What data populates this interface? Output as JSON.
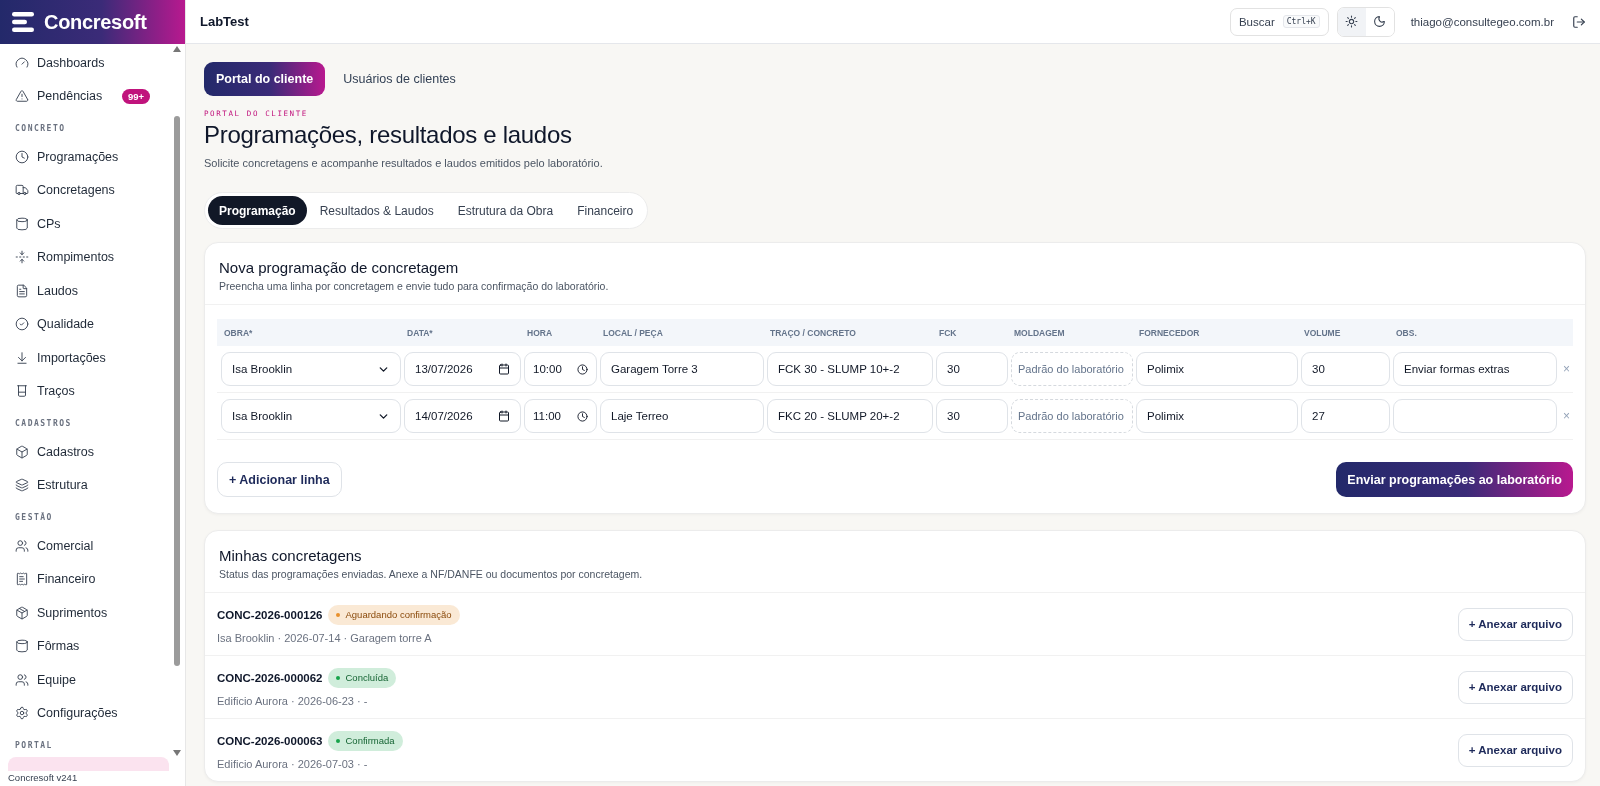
{
  "sidebar": {
    "brand": "Concresoft",
    "sections": [
      {
        "items": [
          {
            "label": "Dashboards",
            "selected": false
          },
          {
            "label": "Pendências",
            "badge": "99+",
            "selected": false
          }
        ]
      },
      {
        "label": "CONCRETO",
        "items": [
          {
            "label": "Programações",
            "selected": false
          },
          {
            "label": "Concretagens",
            "selected": false
          },
          {
            "label": "CPs",
            "selected": false
          },
          {
            "label": "Rompimentos",
            "selected": false
          },
          {
            "label": "Laudos",
            "selected": false
          },
          {
            "label": "Qualidade",
            "selected": false
          },
          {
            "label": "Importações",
            "selected": false
          },
          {
            "label": "Traços",
            "selected": false
          }
        ]
      },
      {
        "label": "CADASTROS",
        "items": [
          {
            "label": "Cadastros",
            "selected": false
          },
          {
            "label": "Estrutura",
            "selected": false
          }
        ]
      },
      {
        "label": "GESTÃO",
        "items": [
          {
            "label": "Comercial",
            "selected": false
          },
          {
            "label": "Financeiro",
            "selected": false
          },
          {
            "label": "Suprimentos",
            "selected": false
          },
          {
            "label": "Fôrmas",
            "selected": false
          },
          {
            "label": "Equipe",
            "selected": false
          },
          {
            "label": "Configurações",
            "selected": false
          }
        ]
      },
      {
        "label": "PORTAL",
        "items": [
          {
            "selected": true
          }
        ]
      }
    ],
    "version": "Concresoft v241"
  },
  "header": {
    "title": "LabTest",
    "search": {
      "label": "Buscar",
      "shortcut": "Ctrl+K"
    },
    "theme": [
      {
        "kind": "light",
        "selected": true
      },
      {
        "kind": "dark",
        "selected": false
      }
    ],
    "user": "thiago@consultegeo.com.br"
  },
  "page_tabs": [
    {
      "label": "Portal do cliente",
      "selected": true
    },
    {
      "label": "Usuários de clientes",
      "selected": false
    }
  ],
  "eyebrow": "PORTAL DO CLIENTE",
  "title": "Programações, resultados e laudos",
  "subtitle": "Solicite concretagens e acompanhe resultados e laudos emitidos pelo laboratório.",
  "tabs": [
    {
      "label": "Programação",
      "selected": true
    },
    {
      "label": "Resultados & Laudos",
      "selected": false
    },
    {
      "label": "Estrutura da Obra",
      "selected": false
    },
    {
      "label": "Financeiro",
      "selected": false
    }
  ],
  "new_schedule": {
    "title": "Nova programação de concretagem",
    "description": "Preencha uma linha por concretagem e envie tudo para confirmação do laboratório.",
    "columns": [
      "OBRA*",
      "DATA*",
      "HORA",
      "LOCAL / PEÇA",
      "TRAÇO / CONCRETO",
      "FCK",
      "MOLDAGEM",
      "FORNECEDOR",
      "VOLUME",
      "OBS."
    ],
    "rows": [
      {
        "obra": "Isa Brooklin",
        "data": "13/07/2026",
        "hora": "10:00",
        "local": "Garagem Torre 3",
        "traco": "FCK 30 - SLUMP 10+-2",
        "fck": "30",
        "moldagem_placeholder": "Padrão do laboratório",
        "fornecedor": "Polimix",
        "volume": "30",
        "obs": "Enviar formas extras",
        "remove": "×"
      },
      {
        "obra": "Isa Brooklin",
        "data": "14/07/2026",
        "hora": "11:00",
        "local": "Laje Terreo",
        "traco": "FKC 20 - SLUMP 20+-2",
        "fck": "30",
        "moldagem_placeholder": "Padrão do laboratório",
        "fornecedor": "Polimix",
        "volume": "27",
        "remove": "×"
      }
    ],
    "add_button": "+ Adicionar linha",
    "submit_button": "Enviar programações ao laboratório"
  },
  "my_concretings": {
    "title": "Minhas concretagens",
    "description": "Status das programações enviadas. Anexe a NF/DANFE ou documentos por concretagem.",
    "items": [
      {
        "code": "CONC-2026-000126",
        "status": "Aguardando confirmação",
        "color": "#e8912d",
        "meta": "Isa Brooklin · 2026-07-14 · Garagem torre A",
        "button": "+ Anexar arquivo"
      },
      {
        "code": "CONC-2026-000062",
        "status": "Concluída",
        "color": "#16a34a",
        "meta": "Edificio Aurora · 2026-06-23 · -",
        "button": "+ Anexar arquivo"
      },
      {
        "code": "CONC-2026-000063",
        "status": "Confirmada",
        "color": "#16a34a",
        "meta": "Edificio Aurora · 2026-07-03 · -",
        "button": "+ Anexar arquivo"
      }
    ]
  }
}
